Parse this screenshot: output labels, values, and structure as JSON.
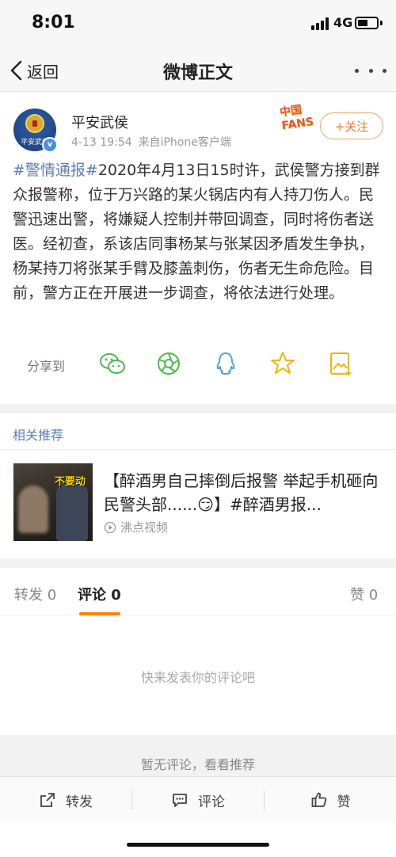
{
  "status_bar": {
    "time": "8:01",
    "network": "4G"
  },
  "nav": {
    "back_label": "返回",
    "title": "微博正文"
  },
  "post": {
    "author": "平安武侯",
    "avatar_text": "平安武侯",
    "date": "4-13 19:54",
    "source": "来自iPhone客户端",
    "fans_badge": "中国FANS",
    "follow_label": "+关注",
    "topic": "#警情通报#",
    "body": "2020年4月13日15时许，武侯警方接到群众报警称，位于万兴路的某火锅店内有人持刀伤人。民警迅速出警，将嫌疑人控制并带回调查，同时将伤者送医。经初查，系该店同事杨某与张某因矛盾发生争执，杨某持刀将张某手臂及膝盖刺伤，伤者无生命危险。目前，警方正在开展进一步调查，将依法进行处理。"
  },
  "share": {
    "label": "分享到",
    "icons": [
      "wechat-icon",
      "moments-icon",
      "qq-icon",
      "qzone-icon",
      "save-image-icon"
    ],
    "colors": {
      "green": "#4cb94d",
      "blue": "#49a3e8",
      "gold": "#f5b400"
    }
  },
  "recommend": {
    "label": "相关推荐",
    "thumb_caption": "不要动",
    "title": "【醉酒男自己摔倒后报警 举起手机砸向民警头部......😏】#醉酒男报...",
    "source": "沸点视频"
  },
  "tabs": {
    "repost": "转发 0",
    "comment": "评论 0",
    "like": "赞 0"
  },
  "comments": {
    "empty_hint": "快来发表你的评论吧",
    "no_comment": "暂无评论，看看推荐"
  },
  "bottom_bar": {
    "repost": "转发",
    "comment": "评论",
    "like": "赞"
  },
  "colors": {
    "link_blue": "#5b7fb5",
    "accent_orange": "#ff8200",
    "follow_orange": "#f27b28"
  }
}
